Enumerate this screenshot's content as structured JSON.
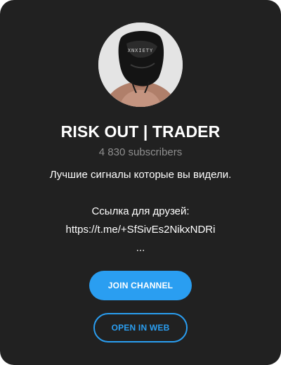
{
  "channel": {
    "name": "RISK OUT | TRADER",
    "subscribers": "4 830 subscribers",
    "avatar_icon": "hooded-person-avatar",
    "description_lines": [
      "Лучшие сигналы которые вы видели.",
      "",
      "Ссылка для друзей:",
      "https://t.me/+SfSivEs2NikxNDRi",
      "..."
    ]
  },
  "buttons": {
    "join_label": "JOIN CHANNEL",
    "web_label": "OPEN IN WEB"
  },
  "colors": {
    "background": "#212121",
    "accent": "#2a9ef1",
    "muted_text": "#8f8f8f"
  }
}
